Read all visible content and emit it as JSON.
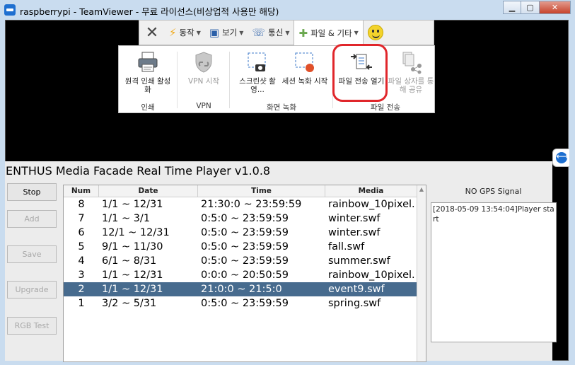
{
  "window": {
    "title": "raspberrypi - TeamViewer - 무료 라이선스(비상업적 사용만 해당)",
    "min_glyph": "▁",
    "max_glyph": "▢",
    "close_glyph": "✕"
  },
  "toolbar": {
    "close_glyph": "✕",
    "items": [
      {
        "label": "동작",
        "icon": "lightning-icon",
        "glyph": "⚡"
      },
      {
        "label": "보기",
        "icon": "monitor-icon",
        "glyph": "▣"
      },
      {
        "label": "통신",
        "icon": "phone-icon",
        "glyph": "☏"
      },
      {
        "label": "파일 & 기타",
        "icon": "puzzle-icon",
        "glyph": "✚"
      }
    ],
    "caret": "▼"
  },
  "ribbon": {
    "items": [
      {
        "label": "원격 인쇄 활성화",
        "icon": "printer-icon"
      },
      {
        "label": "VPN 시작",
        "icon": "vpn-shield-icon"
      },
      {
        "label": "스크린샷 촬영...",
        "icon": "screenshot-icon"
      },
      {
        "label": "세션 녹화 시작",
        "icon": "record-icon"
      },
      {
        "label": "파일 전송 열기",
        "icon": "file-transfer-icon"
      },
      {
        "label": "파일 상자를 통해 공유",
        "icon": "share-files-icon"
      }
    ],
    "groups": [
      "인쇄",
      "VPN",
      "화면 녹화",
      "파일 전송"
    ]
  },
  "player": {
    "title": "ENTHUS Media Facade Real Time Player v1.0.8",
    "buttons": [
      {
        "label": "Stop",
        "enabled": true
      },
      {
        "label": "Add",
        "enabled": false
      },
      {
        "label": "Save",
        "enabled": false
      },
      {
        "label": "Upgrade",
        "enabled": false
      },
      {
        "label": "RGB Test",
        "enabled": false
      }
    ],
    "table": {
      "headers": [
        "Num",
        "Date",
        "Time",
        "Media"
      ],
      "rows": [
        {
          "num": "8",
          "date": "1/1 ~ 12/31",
          "time": "21:30:0 ~ 23:59:59",
          "media": "rainbow_10pixel.",
          "selected": false
        },
        {
          "num": "7",
          "date": "1/1 ~ 3/1",
          "time": "0:5:0 ~ 23:59:59",
          "media": "winter.swf",
          "selected": false
        },
        {
          "num": "6",
          "date": "12/1 ~ 12/31",
          "time": "0:5:0 ~ 23:59:59",
          "media": "winter.swf",
          "selected": false
        },
        {
          "num": "5",
          "date": "9/1 ~ 11/30",
          "time": "0:5:0 ~ 23:59:59",
          "media": "fall.swf",
          "selected": false
        },
        {
          "num": "4",
          "date": "6/1 ~ 8/31",
          "time": "0:5:0 ~ 23:59:59",
          "media": "summer.swf",
          "selected": false
        },
        {
          "num": "3",
          "date": "1/1 ~ 12/31",
          "time": "0:0:0 ~ 20:50:59",
          "media": "rainbow_10pixel.",
          "selected": false
        },
        {
          "num": "2",
          "date": "1/1 ~ 12/31",
          "time": "21:0:0 ~ 21:5:0",
          "media": "event9.swf",
          "selected": true
        },
        {
          "num": "1",
          "date": "3/2 ~ 5/31",
          "time": "0:5:0 ~ 23:59:59",
          "media": "spring.swf",
          "selected": false
        }
      ]
    },
    "gps_status": "NO GPS Signal",
    "log": "[2018-05-09 13:54:04]Player start"
  },
  "colors": {
    "selected_row": "#476b8e",
    "highlight": "#e0262b",
    "title_bg": "#c9dcef"
  }
}
